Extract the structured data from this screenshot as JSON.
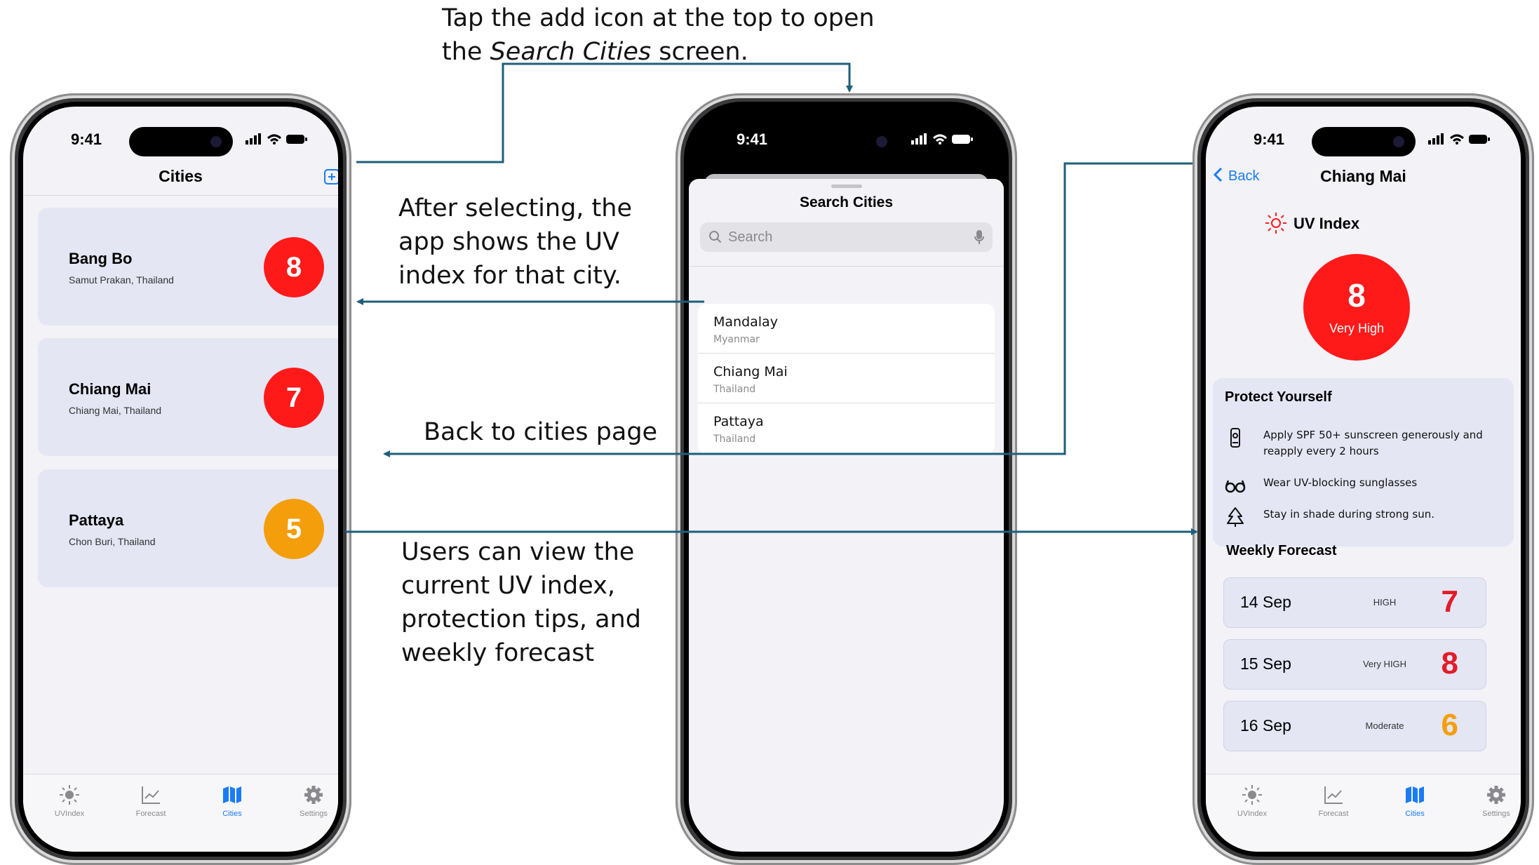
{
  "annotations": {
    "top_line1": "Tap the add icon at the top to open",
    "top_line2_pre": "the ",
    "top_line2_em": "Search Cities",
    "top_line2_post": " screen.",
    "after_select": [
      "After selecting, the",
      "app shows the UV",
      "index for that city."
    ],
    "back": "Back to cities page",
    "users": [
      "Users can view the",
      "current UV index,",
      "protection tips, and",
      "weekly forecast"
    ]
  },
  "status_bar": {
    "time": "9:41"
  },
  "cities_screen": {
    "title": "Cities",
    "cities": [
      {
        "name": "Bang Bo",
        "region": "Samut Prakan, Thailand",
        "uv": "8",
        "color": "#ff1a1a"
      },
      {
        "name": "Chiang Mai",
        "region": "Chiang Mai, Thailand",
        "uv": "7",
        "color": "#ff1a1a"
      },
      {
        "name": "Pattaya",
        "region": "Chon Buri, Thailand",
        "uv": "5",
        "color": "#f59e0b"
      }
    ]
  },
  "tabs": [
    {
      "label": "UVIndex",
      "icon": "sun-icon"
    },
    {
      "label": "Forecast",
      "icon": "chart-icon"
    },
    {
      "label": "Cities",
      "icon": "map-icon"
    },
    {
      "label": "Settings",
      "icon": "gear-icon"
    }
  ],
  "search_screen": {
    "title": "Search Cities",
    "placeholder": "Search",
    "results": [
      {
        "name": "Mandalay",
        "country": "Myanmar"
      },
      {
        "name": "Chiang Mai",
        "country": "Thailand"
      },
      {
        "name": "Pattaya",
        "country": "Thailand"
      }
    ]
  },
  "detail_screen": {
    "back": "Back",
    "title": "Chiang Mai",
    "uv_heading": "UV Index",
    "uv_value": "8",
    "uv_level": "Very High",
    "protect_heading": "Protect Yourself",
    "tips": [
      {
        "text": "Apply SPF 50+ sunscreen generously and reapply every 2 hours",
        "icon": "sunscreen-icon"
      },
      {
        "text": "Wear UV-blocking sunglasses",
        "icon": "sunglasses-icon"
      },
      {
        "text": "Stay in shade during strong sun.",
        "icon": "tree-icon"
      }
    ],
    "forecast_heading": "Weekly Forecast",
    "forecast": [
      {
        "date": "14 Sep",
        "level": "HIGH",
        "value": "7",
        "color": "#e11d2a"
      },
      {
        "date": "15 Sep",
        "level": "Very HIGH",
        "value": "8",
        "color": "#e11d2a"
      },
      {
        "date": "16 Sep",
        "level": "Moderate",
        "value": "6",
        "color": "#f59e0b"
      }
    ]
  },
  "colors": {
    "accent": "#1a7cf5",
    "arrow": "#1f5f7a",
    "card": "#e4e6f4"
  }
}
